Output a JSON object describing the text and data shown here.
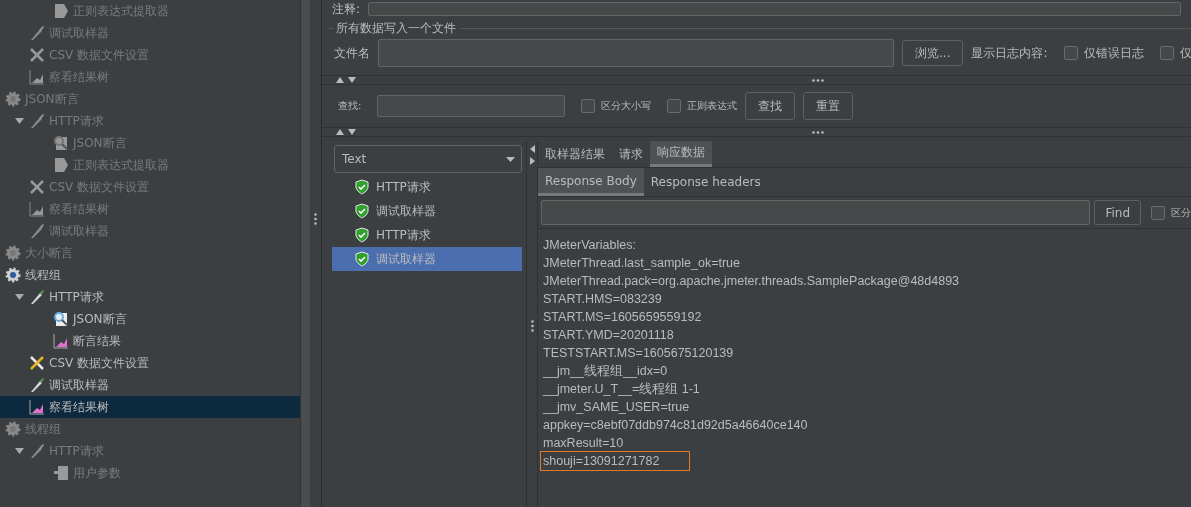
{
  "tree": {
    "continued_children": [
      {
        "label": "正则表达式提取器",
        "kind": "extractor",
        "disabled": true,
        "selected": false
      }
    ],
    "continued_items": [
      {
        "label": "调试取样器",
        "kind": "sampler",
        "disabled": true,
        "selected": false
      },
      {
        "label": "CSV 数据文件设置",
        "kind": "tools",
        "disabled": true,
        "selected": false
      },
      {
        "label": "察看结果树",
        "kind": "chart",
        "disabled": true,
        "selected": false
      }
    ],
    "items": [
      {
        "label": "JSON断言",
        "kind": "gear",
        "disabled": true,
        "selected": false,
        "children": [
          {
            "label": "HTTP请求",
            "kind": "sampler",
            "disabled": true,
            "selected": false,
            "expanded": true,
            "children": [
              {
                "label": "JSON断言",
                "kind": "magnifier",
                "disabled": true,
                "selected": false
              },
              {
                "label": "正则表达式提取器",
                "kind": "extractor",
                "disabled": true,
                "selected": false
              }
            ]
          },
          {
            "label": "CSV 数据文件设置",
            "kind": "tools",
            "disabled": true,
            "selected": false
          },
          {
            "label": "察看结果树",
            "kind": "chart",
            "disabled": true,
            "selected": false
          },
          {
            "label": "调试取样器",
            "kind": "sampler",
            "disabled": true,
            "selected": false
          }
        ]
      },
      {
        "label": "大小断言",
        "kind": "gear",
        "disabled": true,
        "selected": false
      },
      {
        "label": "线程组",
        "kind": "gear",
        "disabled": false,
        "selected": false,
        "children": [
          {
            "label": "HTTP请求",
            "kind": "sampler",
            "disabled": false,
            "selected": false,
            "expanded": true,
            "children": [
              {
                "label": "JSON断言",
                "kind": "magnifier",
                "disabled": false,
                "selected": false
              },
              {
                "label": "断言结果",
                "kind": "chart",
                "disabled": false,
                "selected": false
              }
            ]
          },
          {
            "label": "CSV 数据文件设置",
            "kind": "tools",
            "disabled": false,
            "selected": false
          },
          {
            "label": "调试取样器",
            "kind": "sampler",
            "disabled": false,
            "selected": false
          },
          {
            "label": "察看结果树",
            "kind": "chart",
            "disabled": false,
            "selected": true
          }
        ]
      },
      {
        "label": "线程组",
        "kind": "gear",
        "disabled": true,
        "selected": false,
        "children": [
          {
            "label": "HTTP请求",
            "kind": "sampler",
            "disabled": true,
            "selected": false,
            "expanded": true,
            "children": [
              {
                "label": "用户参数",
                "kind": "params",
                "disabled": true,
                "selected": false
              }
            ]
          }
        ]
      }
    ]
  },
  "comment": {
    "label": "注释:"
  },
  "file_section": {
    "title": "所有数据写入一个文件",
    "file_label": "文件名",
    "browse_button": "浏览...",
    "log_label": "显示日志内容:",
    "options": [
      {
        "label": "仅错误日志",
        "checked": false
      },
      {
        "label": "仅",
        "checked": false
      }
    ]
  },
  "search": {
    "label": "查找:",
    "options": [
      {
        "label": "区分大小写",
        "checked": false
      },
      {
        "label": "正则表达式",
        "checked": false
      }
    ],
    "buttons": [
      "查找",
      "重置"
    ]
  },
  "renderer": {
    "value": "Text"
  },
  "results": [
    {
      "label": "HTTP请求",
      "selected": false
    },
    {
      "label": "调试取样器",
      "selected": false
    },
    {
      "label": "HTTP请求",
      "selected": false
    },
    {
      "label": "调试取样器",
      "selected": true
    }
  ],
  "tabs": [
    {
      "label": "取样器结果",
      "selected": false
    },
    {
      "label": "请求",
      "selected": false
    },
    {
      "label": "响应数据",
      "selected": true
    }
  ],
  "subtabs": [
    {
      "label": "Response Body",
      "selected": true
    },
    {
      "label": "Response headers",
      "selected": false
    }
  ],
  "find": {
    "button": "Find",
    "option": {
      "label": "区分",
      "checked": false
    }
  },
  "response_lines": [
    {
      "text": "JMeterVariables:",
      "highlighted": false
    },
    {
      "text": "JMeterThread.last_sample_ok=true",
      "highlighted": false
    },
    {
      "text": "JMeterThread.pack=org.apache.jmeter.threads.SamplePackage@48d4893",
      "highlighted": false
    },
    {
      "text": "START.HMS=083239",
      "highlighted": false
    },
    {
      "text": "START.MS=1605659559192",
      "highlighted": false
    },
    {
      "text": "START.YMD=20201118",
      "highlighted": false
    },
    {
      "text": "TESTSTART.MS=1605675120139",
      "highlighted": false
    },
    {
      "text": "__jm__线程组__idx=0",
      "highlighted": false
    },
    {
      "text": "__jmeter.U_T__=线程组 1-1",
      "highlighted": false
    },
    {
      "text": "__jmv_SAME_USER=true",
      "highlighted": false
    },
    {
      "text": "appkey=c8ebf07ddb974c81d92d5a46640ce140",
      "highlighted": false
    },
    {
      "text": "maxResult=10",
      "highlighted": false
    },
    {
      "text": "shouji=13091271782",
      "highlighted": true
    }
  ]
}
